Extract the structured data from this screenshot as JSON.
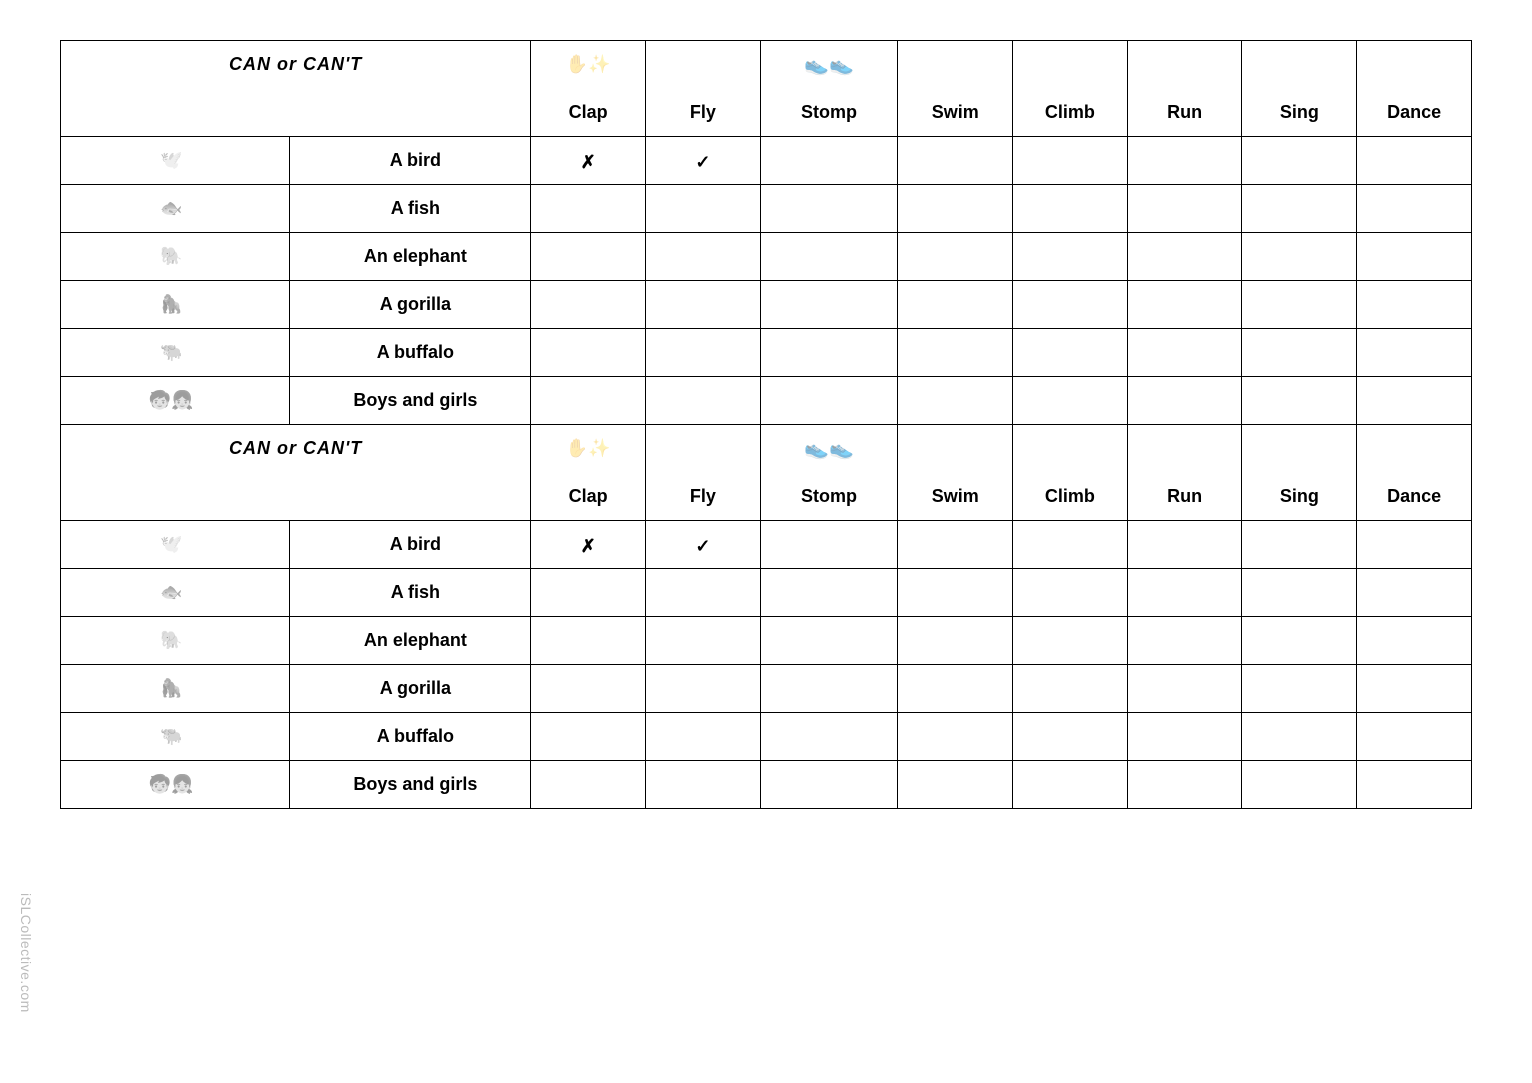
{
  "title": "CAN or CAN'T",
  "actions": [
    "Clap",
    "Fly",
    "Stomp",
    "Swim",
    "Climb",
    "Run",
    "Sing",
    "Dance"
  ],
  "action_icons": {
    "clap": "✋✨",
    "stomp": "👟👟"
  },
  "rows": [
    {
      "icon": "bird-icon",
      "glyph": "🕊️",
      "label": "A bird",
      "marks": [
        "✗",
        "✓",
        "",
        "",
        "",
        "",
        "",
        ""
      ]
    },
    {
      "icon": "fish-icon",
      "glyph": "🐟",
      "label": "A fish",
      "marks": [
        "",
        "",
        "",
        "",
        "",
        "",
        "",
        ""
      ]
    },
    {
      "icon": "elephant-icon",
      "glyph": "🐘",
      "label": "An elephant",
      "marks": [
        "",
        "",
        "",
        "",
        "",
        "",
        "",
        ""
      ]
    },
    {
      "icon": "gorilla-icon",
      "glyph": "🦍",
      "label": "A gorilla",
      "marks": [
        "",
        "",
        "",
        "",
        "",
        "",
        "",
        ""
      ]
    },
    {
      "icon": "buffalo-icon",
      "glyph": "🐃",
      "label": "A buffalo",
      "marks": [
        "",
        "",
        "",
        "",
        "",
        "",
        "",
        ""
      ]
    },
    {
      "icon": "children-icon",
      "glyph": "🧒👧",
      "label": "Boys and girls",
      "marks": [
        "",
        "",
        "",
        "",
        "",
        "",
        "",
        ""
      ]
    }
  ],
  "watermark": "iSLCollective.com"
}
